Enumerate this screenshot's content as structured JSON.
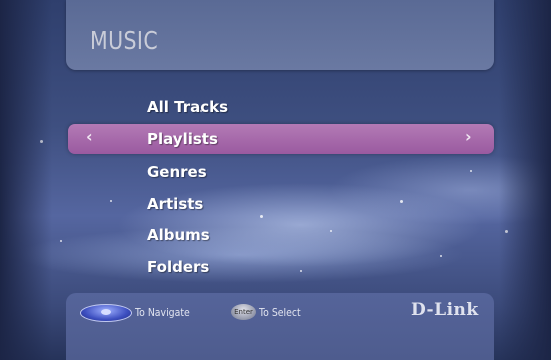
{
  "header": {
    "title": "MUSIC"
  },
  "menu": {
    "items": [
      {
        "label": "All Tracks"
      },
      {
        "label": "Playlists"
      },
      {
        "label": "Genres"
      },
      {
        "label": "Artists"
      },
      {
        "label": "Albums"
      },
      {
        "label": "Folders"
      }
    ],
    "selected_label": "Playlists",
    "left_arrow": "‹",
    "right_arrow": "›"
  },
  "footer": {
    "navigate_hint": "To Navigate",
    "enter_key_label": "Enter",
    "select_hint": "To Select",
    "brand": "D-Link"
  },
  "colors": {
    "background": "#4a5880",
    "highlight": "#a868aa",
    "text": "#ffffff"
  },
  "icons": {
    "navigate": "dpad-icon",
    "select": "enter-key-icon",
    "left": "chevron-left-icon",
    "right": "chevron-right-icon"
  }
}
